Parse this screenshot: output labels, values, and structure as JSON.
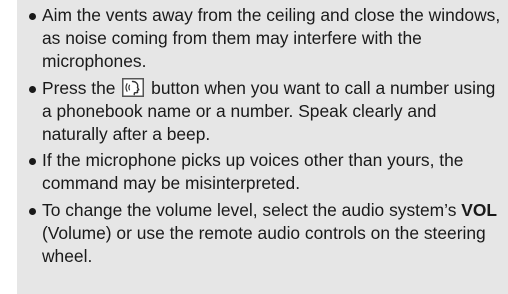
{
  "tips": [
    {
      "text": "Aim the vents away from the ceiling and close the windows, as noise coming from them may interfere with the microphones."
    },
    {
      "text_before": "Press the",
      "icon": "talk-button-icon",
      "text_after": "button when you want to call a number using a phonebook name or a number. Speak clearly and naturally after a beep."
    },
    {
      "text": "If the microphone picks up voices other than yours, the command may be misinterpreted."
    },
    {
      "text_before": "To change the volume level, select the audio system’s",
      "bold": "VOL",
      "text_after": "(Volume) or use the remote audio controls on the steering wheel."
    }
  ]
}
